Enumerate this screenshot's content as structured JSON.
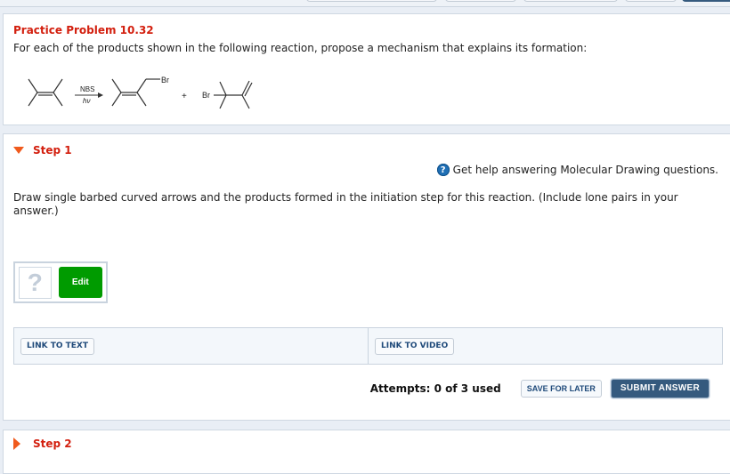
{
  "top_toolbar": {
    "visible_button_stubs": 5
  },
  "problem": {
    "title": "Practice Problem 10.32",
    "prompt": "For each of the products shown in the following reaction, propose a mechanism that explains its formation:",
    "reaction": {
      "reagent_top": "NBS",
      "reagent_bottom": "hν",
      "plus": "+",
      "product1_label": "Br",
      "product2_label": "Br"
    }
  },
  "step1": {
    "label": "Step 1",
    "expanded": true,
    "help_link": "Get help answering Molecular Drawing questions.",
    "instructions": "Draw single barbed curved arrows and the products formed in the initiation step for this reaction. (Include lone pairs in your answer.)",
    "drawing_placeholder": "?",
    "edit_label": "Edit",
    "link_to_text": "LINK TO TEXT",
    "link_to_video": "LINK TO VIDEO",
    "attempts": "Attempts: 0 of 3 used",
    "save_label": "SAVE FOR LATER",
    "submit_label": "SUBMIT ANSWER"
  },
  "step2": {
    "label": "Step 2",
    "expanded": false
  },
  "colors": {
    "accent_red": "#d31f0e",
    "arrow_orange": "#f05a1d",
    "edit_green": "#009b00",
    "submit_navy": "#355a7e",
    "link_blue": "#1f4a7a"
  }
}
